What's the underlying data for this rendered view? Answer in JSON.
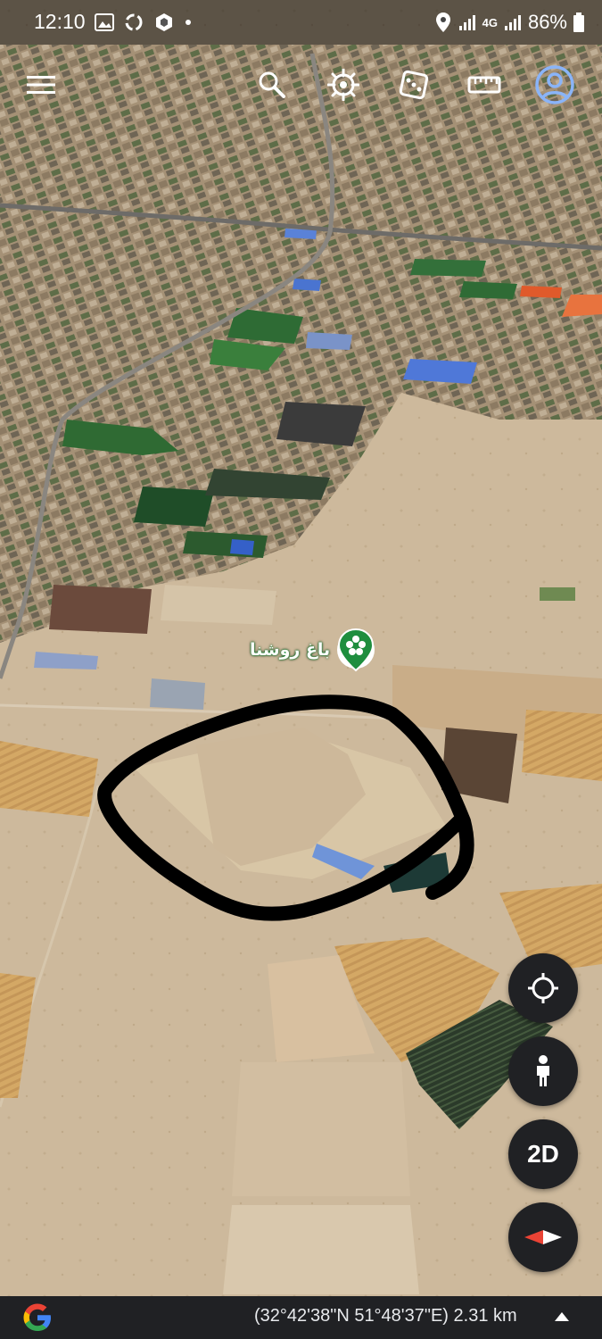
{
  "status_bar": {
    "time": "12:10",
    "network": "4G",
    "battery": "86%",
    "notification_icons": [
      "gallery-icon",
      "sync-icon",
      "app-icon",
      "dot-icon"
    ],
    "tray_icons": [
      "location-icon",
      "signal-icon",
      "signal-4g-icon",
      "signal-icon-2",
      "battery-icon"
    ]
  },
  "toolbar": {
    "icons": [
      "menu-icon",
      "search-icon",
      "voyager-icon",
      "feeling-lucky-icon",
      "measure-icon",
      "account-icon"
    ]
  },
  "map": {
    "poi_label": "باغ روشنا",
    "poi_icon": "flower-place-icon",
    "annotation": "hand-drawn-black-circle"
  },
  "controls": {
    "my_location_icon": "my-location-icon",
    "street_view_icon": "pegman-icon",
    "view_mode_label": "2D",
    "compass_icon": "compass-icon"
  },
  "bottom_bar": {
    "logo": "google-g-logo",
    "coordinates": "(32°42'38\"N 51°48'37\"E) 2.31 km",
    "expand_icon": "expand-up-icon"
  },
  "colors": {
    "status_bar_bg": "#000000",
    "control_bg": "#202124",
    "account_icon": "#8ab4f8",
    "poi_green": "#1e8e3e"
  }
}
